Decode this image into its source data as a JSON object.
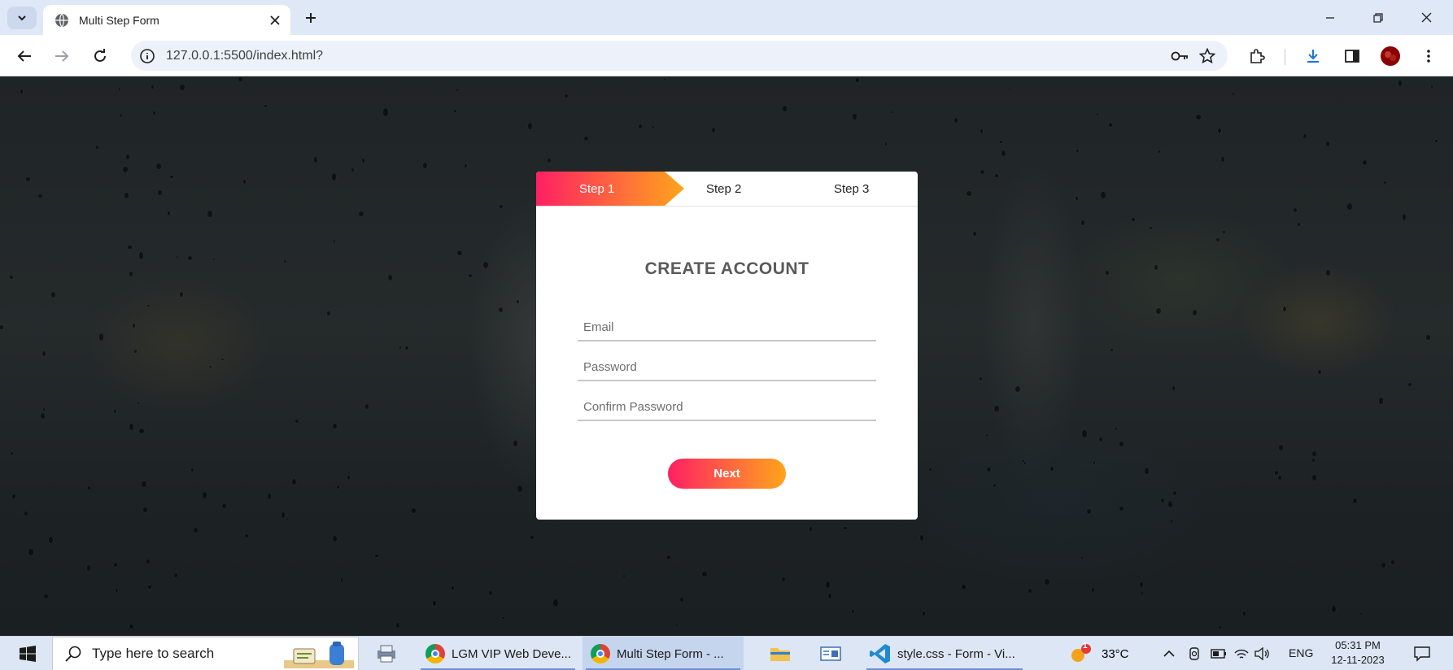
{
  "browser": {
    "tab_title": "Multi Step Form",
    "url": "127.0.0.1:5500/index.html?"
  },
  "form": {
    "steps": [
      "Step 1",
      "Step 2",
      "Step 3"
    ],
    "active_step": 1,
    "title": "CREATE ACCOUNT",
    "email_placeholder": "Email",
    "password_placeholder": "Password",
    "confirm_placeholder": "Confirm Password",
    "next_label": "Next",
    "accent_start": "#ff1f63",
    "accent_end": "#ffa41b"
  },
  "taskbar": {
    "search_placeholder": "Type here to search",
    "apps": [
      {
        "label": "LGM VIP Web Deve..."
      },
      {
        "label": "Multi Step Form - ..."
      },
      {
        "label": "style.css - Form - Vi..."
      }
    ],
    "weather_temp": "33°C",
    "weather_badge": "1",
    "language": "ENG",
    "time": "05:31 PM",
    "date": "12-11-2023"
  }
}
